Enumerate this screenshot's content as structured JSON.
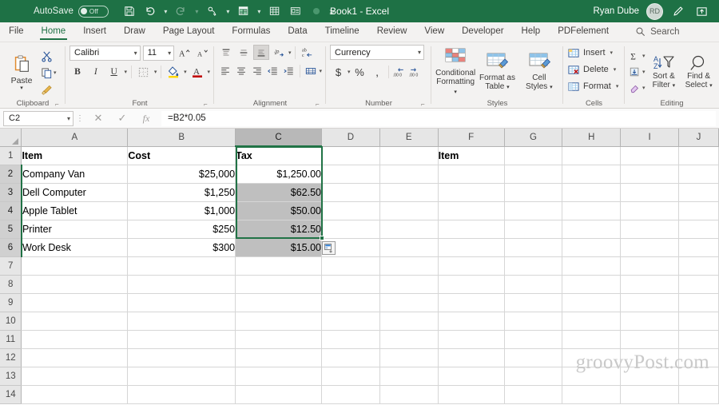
{
  "titlebar": {
    "autosave_label": "AutoSave",
    "autosave_state": "Off",
    "document_title": "Book1  -  Excel",
    "user_name": "Ryan Dube",
    "user_initials": "RD",
    "quick_access": [
      {
        "name": "save-icon",
        "label": "Save"
      },
      {
        "name": "undo-icon",
        "label": "Undo"
      },
      {
        "name": "redo-icon",
        "label": "Redo"
      },
      {
        "name": "touch-mouse-mode-icon",
        "label": "Touch/Mouse Mode"
      },
      {
        "name": "pivot-table-icon",
        "label": "PivotTable"
      },
      {
        "name": "table-icon",
        "label": "Table"
      },
      {
        "name": "form-icon",
        "label": "Form"
      },
      {
        "name": "record-macro-icon",
        "label": "Record Macro"
      },
      {
        "name": "customize-qat-icon",
        "label": "Customize Quick Access Toolbar"
      }
    ],
    "ribbon_display_icon": "ribbon-display-options-icon",
    "pen_icon": "pen-icon",
    "accent_color": "#1e7145"
  },
  "tabs": [
    {
      "label": "File",
      "active": false
    },
    {
      "label": "Home",
      "active": true
    },
    {
      "label": "Insert",
      "active": false
    },
    {
      "label": "Draw",
      "active": false
    },
    {
      "label": "Page Layout",
      "active": false
    },
    {
      "label": "Formulas",
      "active": false
    },
    {
      "label": "Data",
      "active": false
    },
    {
      "label": "Timeline",
      "active": false
    },
    {
      "label": "Review",
      "active": false
    },
    {
      "label": "View",
      "active": false
    },
    {
      "label": "Developer",
      "active": false
    },
    {
      "label": "Help",
      "active": false
    },
    {
      "label": "PDFelement",
      "active": false
    }
  ],
  "search": {
    "label": "Search",
    "icon": "search-icon"
  },
  "ribbon": {
    "clipboard": {
      "group_label": "Clipboard",
      "paste_label": "Paste",
      "cut_label": "Cut",
      "copy_label": "Copy",
      "format_painter_label": "Format Painter"
    },
    "font": {
      "group_label": "Font",
      "font_family": "Calibri",
      "font_size": "11",
      "grow_font_label": "A",
      "shrink_font_label": "A",
      "bold_label": "B",
      "italic_label": "I",
      "underline_label": "U",
      "borders_label": "Borders",
      "fill_color_label": "Fill Color",
      "font_color_label": "A"
    },
    "alignment": {
      "group_label": "Alignment",
      "top_align": "Top Align",
      "middle_align": "Middle Align",
      "bottom_align": "Bottom Align",
      "orientation": "Orientation",
      "wrap_text": "Wrap Text",
      "align_left": "Align Left",
      "center": "Center",
      "align_right": "Align Right",
      "decrease_indent": "Decrease Indent",
      "increase_indent": "Increase Indent",
      "merge_center": "Merge & Center"
    },
    "number": {
      "group_label": "Number",
      "format": "Currency",
      "accounting_label": "$",
      "percent_label": "%",
      "comma_label": ",",
      "increase_decimal_label": "Increase Decimal",
      "decrease_decimal_label": "Decrease Decimal"
    },
    "styles": {
      "group_label": "Styles",
      "items": [
        {
          "line1": "Conditional",
          "line2": "Formatting",
          "caret": true
        },
        {
          "line1": "Format as",
          "line2": "Table",
          "caret": true
        },
        {
          "line1": "Cell",
          "line2": "Styles",
          "caret": true
        }
      ]
    },
    "cells": {
      "group_label": "Cells",
      "items": [
        {
          "label": "Insert"
        },
        {
          "label": "Delete"
        },
        {
          "label": "Format"
        }
      ]
    },
    "editing": {
      "group_label": "Editing",
      "autosum_label": "AutoSum",
      "fill_label": "Fill",
      "clear_label": "Clear",
      "sort_filter": {
        "line1": "Sort &",
        "line2": "Filter"
      },
      "find_select": {
        "line1": "Find &",
        "line2": "Select"
      }
    }
  },
  "formula_bar": {
    "name_box": "C2",
    "cancel_icon": "close-icon",
    "enter_icon": "check-icon",
    "function_icon": "fx-icon",
    "formula": "=B2*0.05"
  },
  "sheet": {
    "columns": [
      "A",
      "B",
      "C",
      "D",
      "E",
      "F",
      "G",
      "H",
      "I",
      "J"
    ],
    "selected_column": "C",
    "rows": [
      "1",
      "2",
      "3",
      "4",
      "5",
      "6",
      "7",
      "8",
      "9",
      "10",
      "11",
      "12",
      "13",
      "14"
    ],
    "selected_rows": [
      "2",
      "3",
      "4",
      "5",
      "6"
    ],
    "data": [
      {
        "row": "1",
        "A": "Item",
        "B": "Cost",
        "C": "Tax",
        "D": "",
        "E": "",
        "F": "Item",
        "G": "",
        "H": "",
        "I": "",
        "J": "",
        "bold": true
      },
      {
        "row": "2",
        "A": "Company Van",
        "B": "$25,000",
        "C": "$1,250.00",
        "D": "",
        "E": "",
        "F": "",
        "G": "",
        "H": "",
        "I": "",
        "J": "",
        "bold": false
      },
      {
        "row": "3",
        "A": "Dell Computer",
        "B": "$1,250",
        "C": "$62.50",
        "D": "",
        "E": "",
        "F": "",
        "G": "",
        "H": "",
        "I": "",
        "J": "",
        "bold": false
      },
      {
        "row": "4",
        "A": "Apple Tablet",
        "B": "$1,000",
        "C": "$50.00",
        "D": "",
        "E": "",
        "F": "",
        "G": "",
        "H": "",
        "I": "",
        "J": "",
        "bold": false
      },
      {
        "row": "5",
        "A": "Printer",
        "B": "$250",
        "C": "$12.50",
        "D": "",
        "E": "",
        "F": "",
        "G": "",
        "H": "",
        "I": "",
        "J": "",
        "bold": false
      },
      {
        "row": "6",
        "A": "Work Desk",
        "B": "$300",
        "C": "$15.00",
        "D": "",
        "E": "",
        "F": "",
        "G": "",
        "H": "",
        "I": "",
        "J": "",
        "bold": false
      },
      {
        "row": "7",
        "A": "",
        "B": "",
        "C": "",
        "D": "",
        "E": "",
        "F": "",
        "G": "",
        "H": "",
        "I": "",
        "J": "",
        "bold": false
      },
      {
        "row": "8",
        "A": "",
        "B": "",
        "C": "",
        "D": "",
        "E": "",
        "F": "",
        "G": "",
        "H": "",
        "I": "",
        "J": "",
        "bold": false
      },
      {
        "row": "9",
        "A": "",
        "B": "",
        "C": "",
        "D": "",
        "E": "",
        "F": "",
        "G": "",
        "H": "",
        "I": "",
        "J": "",
        "bold": false
      },
      {
        "row": "10",
        "A": "",
        "B": "",
        "C": "",
        "D": "",
        "E": "",
        "F": "",
        "G": "",
        "H": "",
        "I": "",
        "J": "",
        "bold": false
      },
      {
        "row": "11",
        "A": "",
        "B": "",
        "C": "",
        "D": "",
        "E": "",
        "F": "",
        "G": "",
        "H": "",
        "I": "",
        "J": "",
        "bold": false
      },
      {
        "row": "12",
        "A": "",
        "B": "",
        "C": "",
        "D": "",
        "E": "",
        "F": "",
        "G": "",
        "H": "",
        "I": "",
        "J": "",
        "bold": false
      },
      {
        "row": "13",
        "A": "",
        "B": "",
        "C": "",
        "D": "",
        "E": "",
        "F": "",
        "G": "",
        "H": "",
        "I": "",
        "J": "",
        "bold": false
      },
      {
        "row": "14",
        "A": "",
        "B": "",
        "C": "",
        "D": "",
        "E": "",
        "F": "",
        "G": "",
        "H": "",
        "I": "",
        "J": "",
        "bold": false
      }
    ],
    "autofill_options_icon": "auto-fill-options-icon",
    "selection_color": "#217346"
  },
  "watermark": "groovyPost.com"
}
